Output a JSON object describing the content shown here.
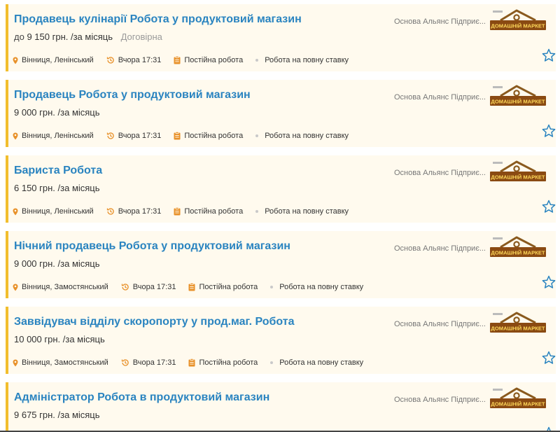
{
  "colors": {
    "accent_border": "#f2be2e",
    "title": "#2a84c0",
    "card_bg": "#fffaee",
    "icon_orange": "#e8912a"
  },
  "logo_text": "ДОМАШНІЙ МАРКЕТ",
  "jobs": [
    {
      "title": "Продавець кулінарії Робота у продуктовий магазин",
      "salary_prefix": "до",
      "salary": "9 150 грн.",
      "period": "/за місяць",
      "negotiable": "Договірна",
      "location": "Вінниця, Ленінський",
      "time": "Вчора 17:31",
      "employment": "Постійна робота",
      "schedule": "Робота на повну ставку",
      "company": "Основа Альянс Підприє..."
    },
    {
      "title": "Продавець Робота у продуктовий магазин",
      "salary_prefix": "",
      "salary": "9 000 грн.",
      "period": "/за місяць",
      "negotiable": "",
      "location": "Вінниця, Ленінський",
      "time": "Вчора 17:31",
      "employment": "Постійна робота",
      "schedule": "Робота на повну ставку",
      "company": "Основа Альянс Підприє..."
    },
    {
      "title": "Бариста Робота",
      "salary_prefix": "",
      "salary": "6 150 грн.",
      "period": "/за місяць",
      "negotiable": "",
      "location": "Вінниця, Ленінський",
      "time": "Вчора 17:31",
      "employment": "Постійна робота",
      "schedule": "Робота на повну ставку",
      "company": "Основа Альянс Підприє..."
    },
    {
      "title": "Нічний продавець Робота у продуктовий магазин",
      "salary_prefix": "",
      "salary": "9 000 грн.",
      "period": "/за місяць",
      "negotiable": "",
      "location": "Вінниця, Замостянський",
      "time": "Вчора 17:31",
      "employment": "Постійна робота",
      "schedule": "Робота на повну ставку",
      "company": "Основа Альянс Підприє..."
    },
    {
      "title": "Заввідувач відділу скоропорту у прод.маг. Робота",
      "salary_prefix": "",
      "salary": "10 000 грн.",
      "period": "/за місяць",
      "negotiable": "",
      "location": "Вінниця, Замостянський",
      "time": "Вчора 17:31",
      "employment": "Постійна робота",
      "schedule": "Робота на повну ставку",
      "company": "Основа Альянс Підприє..."
    },
    {
      "title": "Адміністратор Робота в продуктовий магазин",
      "salary_prefix": "",
      "salary": "9 675 грн.",
      "period": "/за місяць",
      "negotiable": "",
      "location": "",
      "time": "",
      "employment": "",
      "schedule": "",
      "company": "Основа Альянс Підприє..."
    }
  ]
}
